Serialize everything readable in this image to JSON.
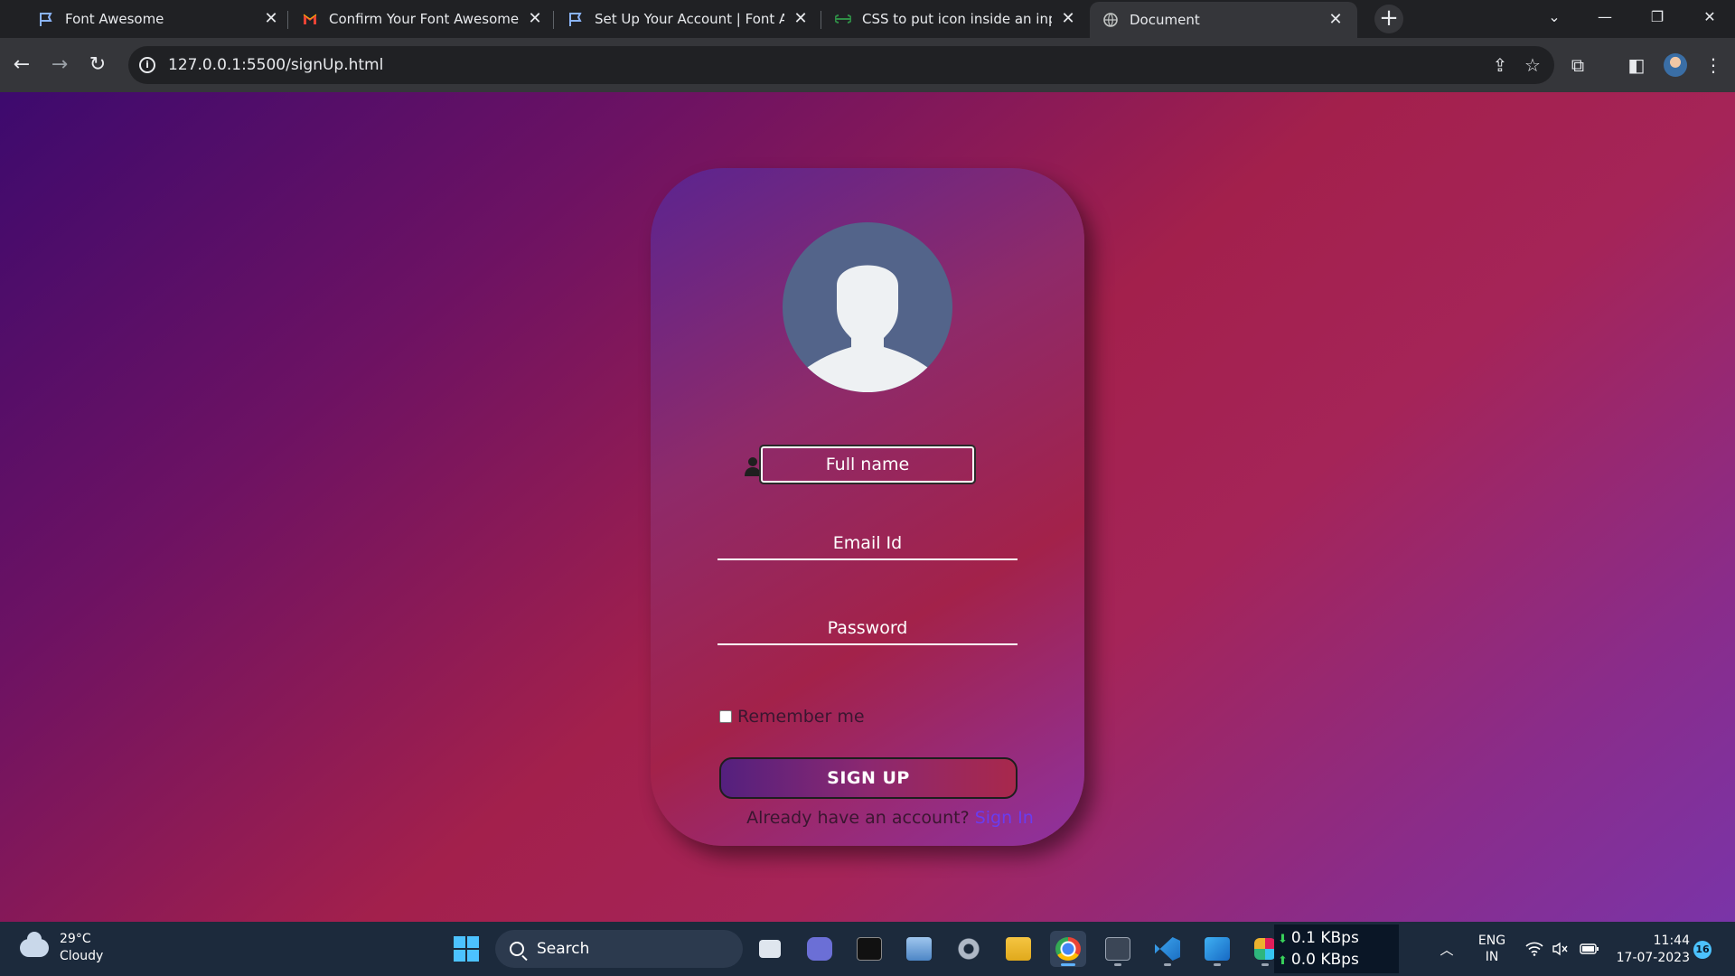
{
  "browser": {
    "tabs": [
      {
        "title": "Font Awesome",
        "icon": "flag-icon",
        "active": false
      },
      {
        "title": "Confirm Your Font Awesome Ac",
        "icon": "gmail-icon",
        "active": false
      },
      {
        "title": "Set Up Your Account | Font Awe",
        "icon": "flag-icon",
        "active": false
      },
      {
        "title": "CSS to put icon inside an input",
        "icon": "geeksforgeeks-icon",
        "active": false
      },
      {
        "title": "Document",
        "icon": "globe-icon",
        "active": true
      }
    ],
    "url": "127.0.0.1:5500/signUp.html"
  },
  "form": {
    "fullname_placeholder": "Full name",
    "email_placeholder": "Email Id",
    "password_placeholder": "Password",
    "remember_label": "Remember me",
    "remember_checked": false,
    "signup_label": "SIGN UP",
    "account_prompt": "Already have an account? ",
    "signin_link": "Sign In"
  },
  "taskbar": {
    "weather_temp": "29°C",
    "weather_desc": "Cloudy",
    "search_label": "Search",
    "net_down": "0.1 KBps",
    "net_up": "0.0 KBps",
    "lang_top": "ENG",
    "lang_bottom": "IN",
    "time": "11:44",
    "date": "17-07-2023",
    "notification_count": "16"
  },
  "colors": {
    "accent_link": "#6a3cf0",
    "taskbar_bg": "#1c2a3c",
    "page_gradient": [
      "#3d0a6e",
      "#a3204c",
      "#7a34a8"
    ]
  }
}
